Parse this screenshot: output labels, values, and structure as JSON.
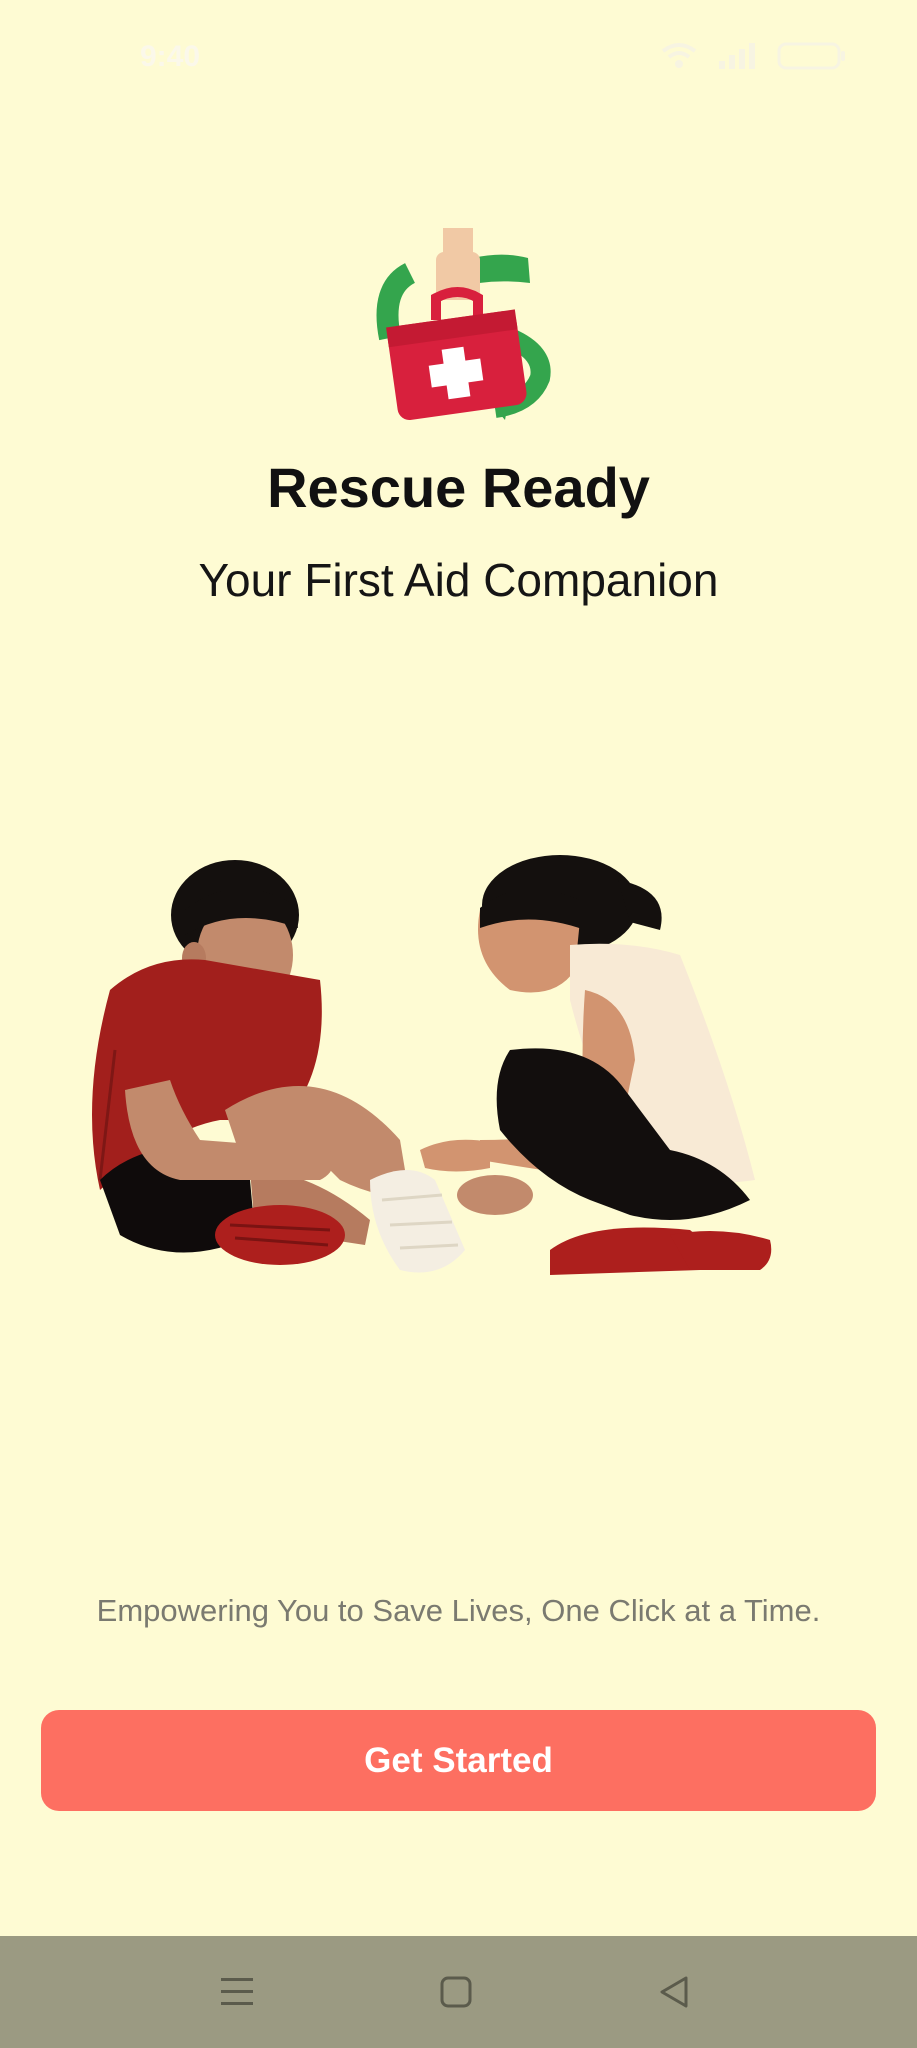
{
  "status_bar": {
    "time": "9:40",
    "icons": [
      "wifi-icon",
      "signal-icon",
      "battery-icon"
    ]
  },
  "app": {
    "title": "Rescue Ready",
    "subtitle": "Your First Aid Companion",
    "tagline": "Empowering You to Save Lives, One Click at a Time.",
    "get_started_label": "Get Started"
  },
  "navigation": {
    "buttons": [
      "menu-icon",
      "home-icon",
      "back-icon"
    ]
  },
  "colors": {
    "background": "#fefbd3",
    "button": "#fd6f61",
    "nav_bar": "#9b9a82",
    "logo_red": "#d8203d",
    "logo_green": "#34a54d"
  }
}
